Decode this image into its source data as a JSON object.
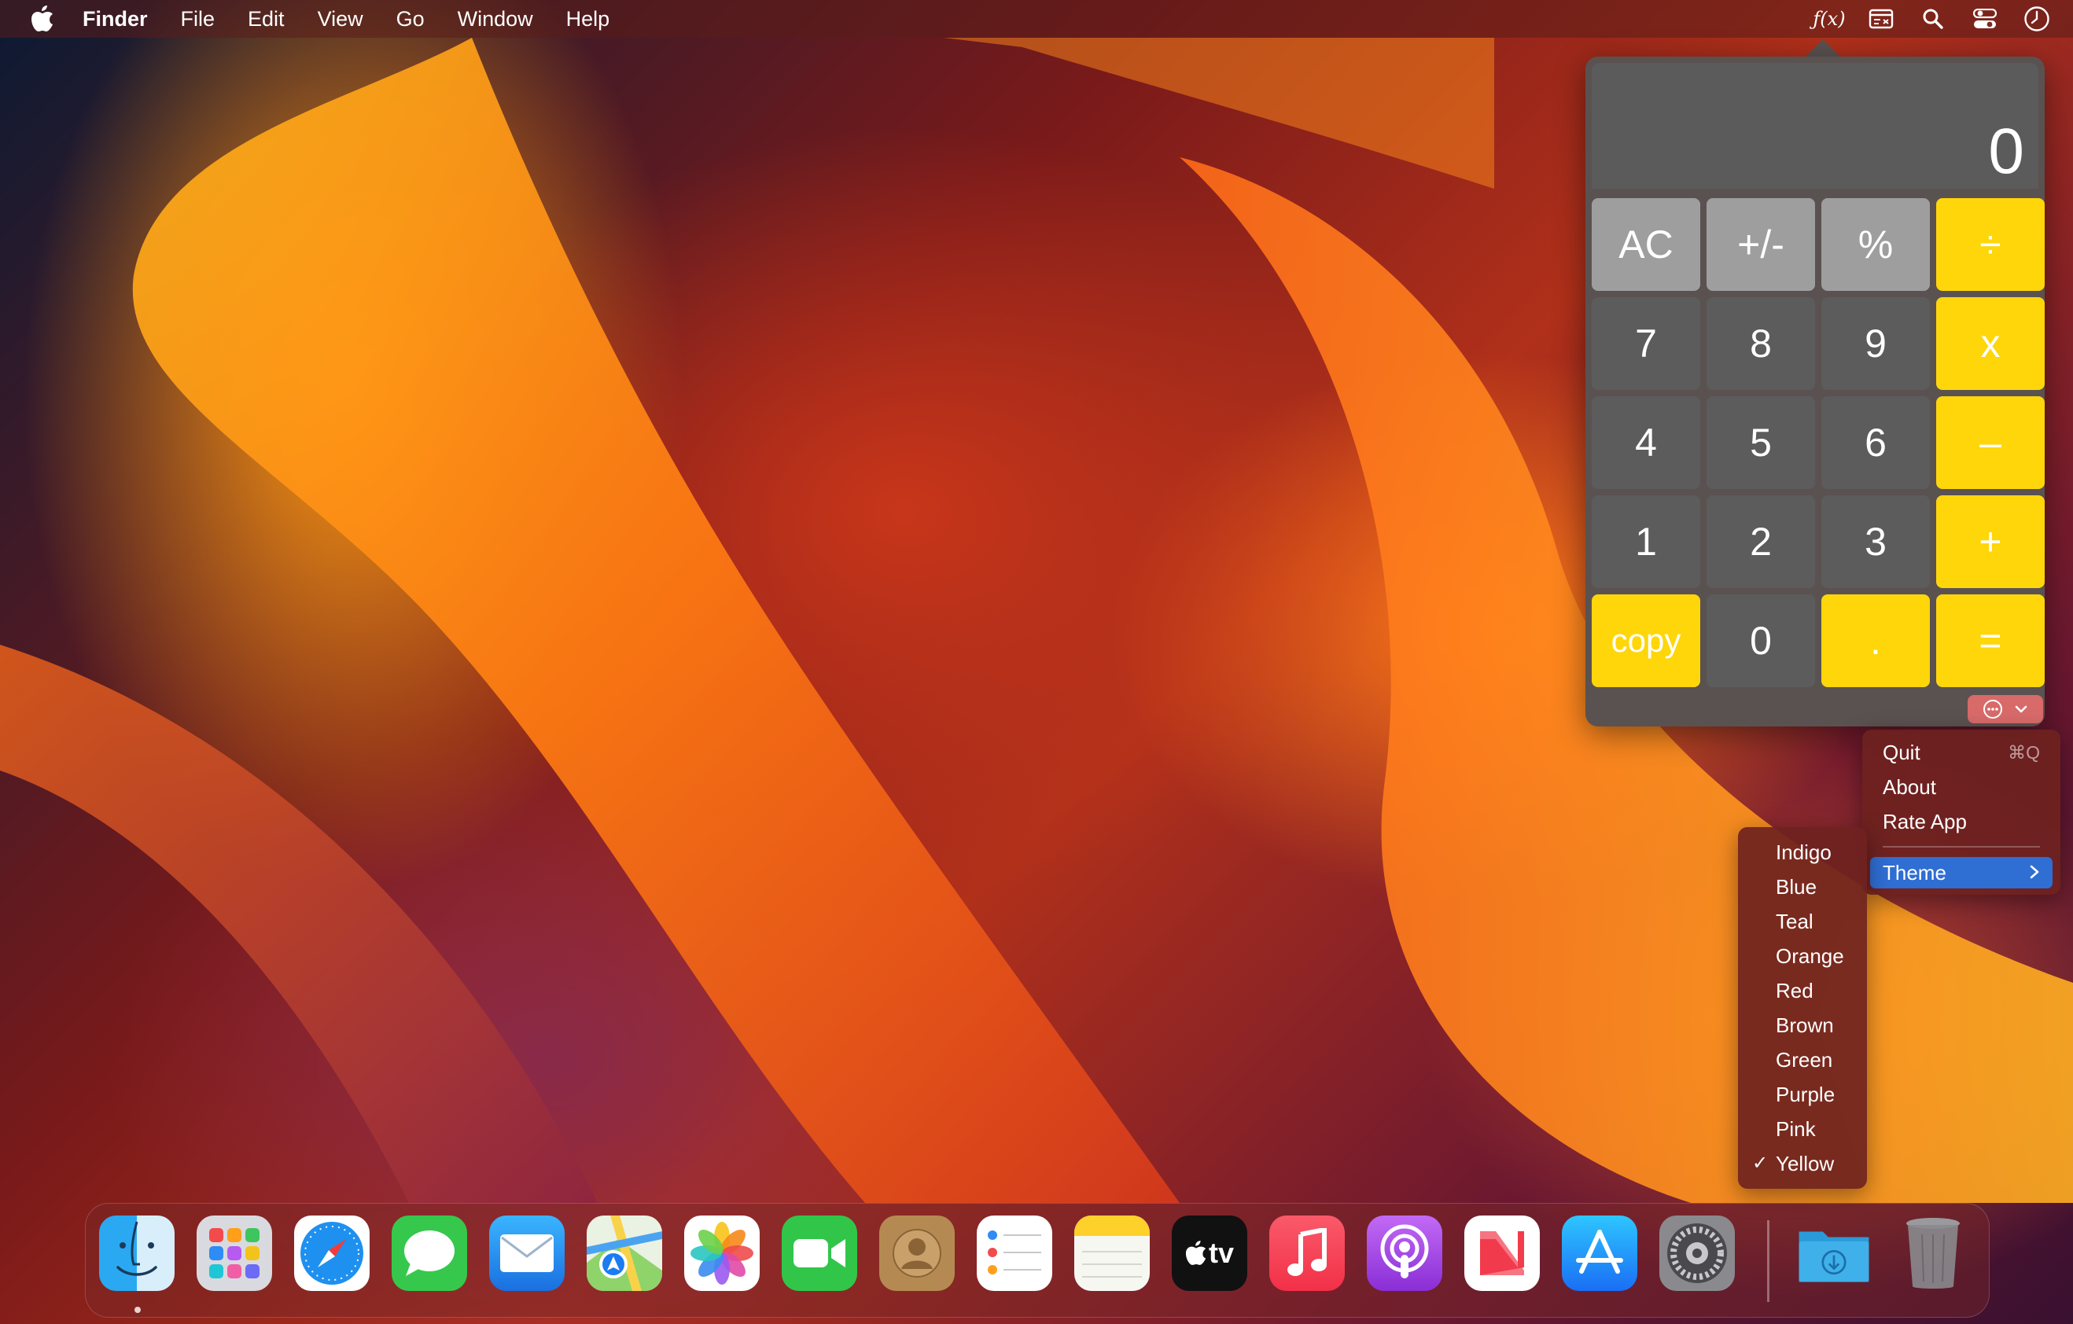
{
  "menubar": {
    "app_name": "Finder",
    "items": [
      "File",
      "Edit",
      "View",
      "Go",
      "Window",
      "Help"
    ],
    "status_icons": [
      "function-icon",
      "window-icon",
      "search-icon",
      "control-center-icon",
      "clock-icon"
    ],
    "function_label": "ƒ(x)"
  },
  "calculator": {
    "display_value": "0",
    "keys": {
      "ac": "AC",
      "sign": "+/-",
      "percent": "%",
      "divide": "÷",
      "seven": "7",
      "eight": "8",
      "nine": "9",
      "multiply": "x",
      "four": "4",
      "five": "5",
      "six": "6",
      "minus": "–",
      "one": "1",
      "two": "2",
      "three": "3",
      "plus": "+",
      "copy": "copy",
      "zero": "0",
      "decimal": ".",
      "equals": "="
    },
    "colors": {
      "operator": "#fed60a",
      "function": "#9e9e9e",
      "number": "#5c5c5c",
      "display": "#5b5b5b"
    }
  },
  "menu": {
    "quit": "Quit",
    "quit_shortcut": "⌘Q",
    "about": "About",
    "rate": "Rate App",
    "theme": "Theme",
    "highlight_color": "#2f6ed3"
  },
  "theme_submenu": {
    "items": [
      "Indigo",
      "Blue",
      "Teal",
      "Orange",
      "Red",
      "Brown",
      "Green",
      "Purple",
      "Pink",
      "Yellow"
    ],
    "selected": "Yellow",
    "check": "✓"
  },
  "dock": {
    "apps": [
      "Finder",
      "Launchpad",
      "Safari",
      "Messages",
      "Mail",
      "Maps",
      "Photos",
      "FaceTime",
      "Contacts",
      "Reminders",
      "Notes",
      "Apple TV",
      "Music",
      "Podcasts",
      "News",
      "App Store",
      "System Settings",
      "Downloads",
      "Trash"
    ],
    "appletv_label": "tv"
  }
}
